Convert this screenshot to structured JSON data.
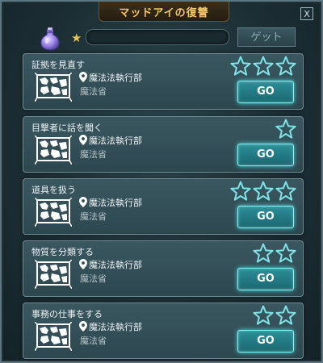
{
  "window": {
    "title": "マッドアイの復讐",
    "close_label": "X"
  },
  "header": {
    "reward_icon": "potion-icon",
    "star_icon": "star-icon",
    "progress": 0,
    "get_label": "ゲット"
  },
  "quests": [
    {
      "title": "証拠を見直す",
      "dept": "魔法法執行部",
      "ministry": "魔法省",
      "stars_total": 3,
      "go_label": "GO"
    },
    {
      "title": "目撃者に話を聞く",
      "dept": "魔法法執行部",
      "ministry": "魔法省",
      "stars_total": 1,
      "go_label": "GO"
    },
    {
      "title": "道具を扱う",
      "dept": "魔法法執行部",
      "ministry": "魔法省",
      "stars_total": 3,
      "go_label": "GO"
    },
    {
      "title": "物質を分類する",
      "dept": "魔法法執行部",
      "ministry": "魔法省",
      "stars_total": 2,
      "go_label": "GO"
    },
    {
      "title": "事務の仕事をする",
      "dept": "魔法法執行部",
      "ministry": "魔法省",
      "stars_total": 2,
      "go_label": "GO"
    }
  ],
  "colors": {
    "title": "#f0c668",
    "go_button": "#2b8f98",
    "star_outline": "#7fe3e8",
    "star_filled": "#e8c34f"
  }
}
